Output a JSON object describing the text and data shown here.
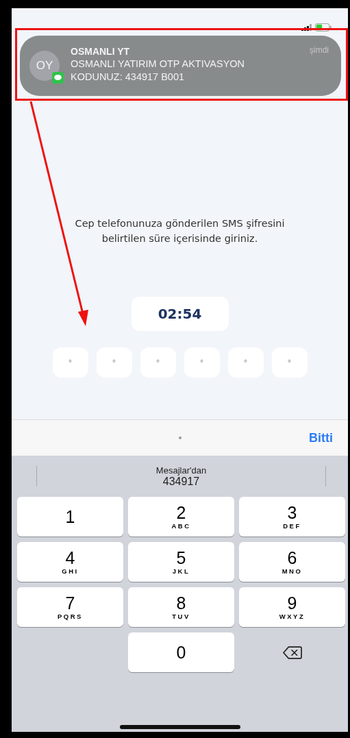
{
  "notification": {
    "avatar": "OY",
    "sender": "OSMANLI YT",
    "time": "şimdi",
    "message": "OSMANLI YATIRIM OTP AKTIVASYON KODUNUZ: 434917 B001"
  },
  "instruction": "Cep telefonunuza gönderilen SMS şifresini belirtilen süre içerisinde giriniz.",
  "timer": "02:54",
  "code_fields": [
    {
      "placeholder": "*"
    },
    {
      "placeholder": "*"
    },
    {
      "placeholder": "*"
    },
    {
      "placeholder": "*"
    },
    {
      "placeholder": "*"
    },
    {
      "placeholder": "*"
    }
  ],
  "toolbar": {
    "done": "Bitti"
  },
  "suggestion": {
    "source": "Mesajlar'dan",
    "code": "434917"
  },
  "keys": [
    {
      "kind": "digit",
      "digit": "1"
    },
    {
      "kind": "digit",
      "digit": "2",
      "letters": "ABC"
    },
    {
      "kind": "digit",
      "digit": "3",
      "letters": "DEF"
    },
    {
      "kind": "digit",
      "digit": "4",
      "letters": "GHI"
    },
    {
      "kind": "digit",
      "digit": "5",
      "letters": "JKL"
    },
    {
      "kind": "digit",
      "digit": "6",
      "letters": "MNO"
    },
    {
      "kind": "digit",
      "digit": "7",
      "letters": "PQRS"
    },
    {
      "kind": "digit",
      "digit": "8",
      "letters": "TUV"
    },
    {
      "kind": "digit",
      "digit": "9",
      "letters": "WXYZ"
    },
    {
      "kind": "blank"
    },
    {
      "kind": "digit",
      "digit": "0"
    },
    {
      "kind": "delete"
    }
  ]
}
